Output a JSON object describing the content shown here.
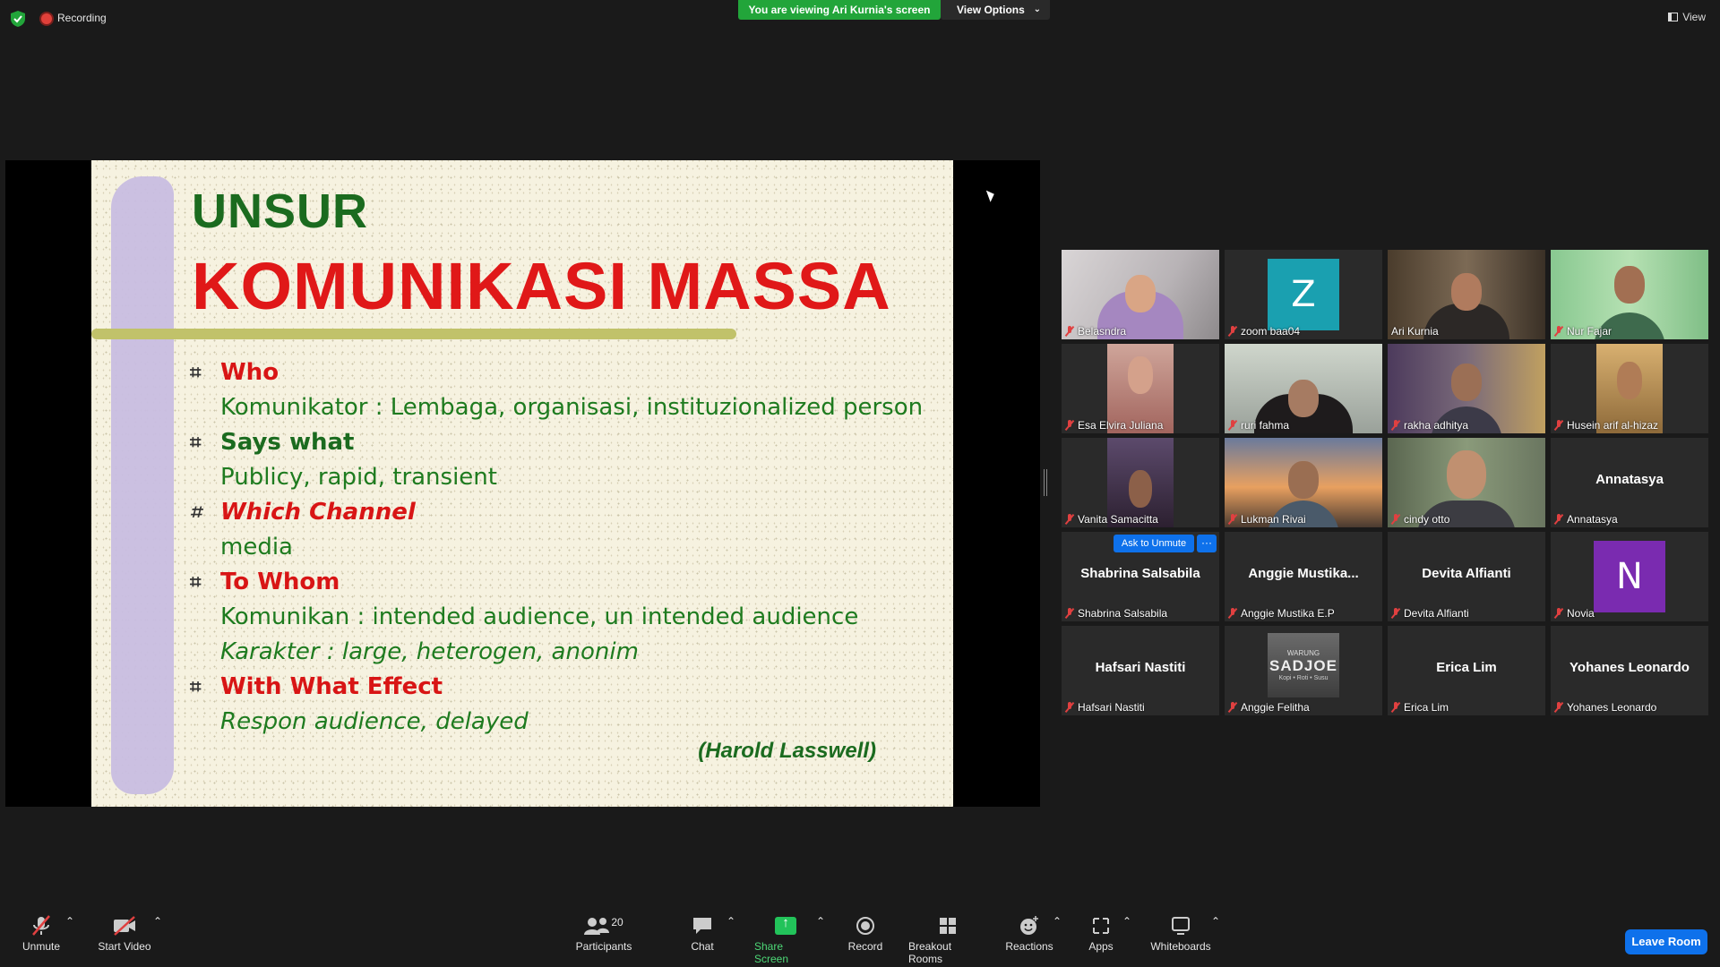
{
  "topbar": {
    "recording_label": "Recording",
    "viewing_banner": "You are viewing Ari Kurnia's screen",
    "view_options_label": "View Options",
    "view_label": "View"
  },
  "slide": {
    "title_line1": "UNSUR",
    "title_line2": "KOMUNIKASI MASSA",
    "lines": [
      "Who",
      "Komunikator : Lembaga, organisasi, instituzionalized person",
      "Says what",
      "Publicy, rapid, transient",
      "Which Channel",
      "media",
      "To Whom",
      "Komunikan : intended audience, un intended audience",
      "Karakter : large, heterogen, anonim",
      "With What Effect",
      "Respon audience, delayed"
    ],
    "attribution": "(Harold Lasswell)"
  },
  "gallery": {
    "ask_to_unmute_label": "Ask to Unmute",
    "more_label": "···",
    "participants": [
      {
        "name": "Belasndra"
      },
      {
        "name": "zoom baa04",
        "avatar_letter": "Z",
        "avatar_color": "#1aa0b0"
      },
      {
        "name": "Ari Kurnia"
      },
      {
        "name": "Nur Fajar"
      },
      {
        "name": "Esa Elvira Juliana"
      },
      {
        "name": "ruri fahma"
      },
      {
        "name": "rakha adhitya"
      },
      {
        "name": "Husein arif al-hizaz"
      },
      {
        "name": "Vanita Samacitta"
      },
      {
        "name": "Lukman Rivai"
      },
      {
        "name": "cindy otto"
      },
      {
        "name": "Annatasya",
        "display_name": "Annatasya"
      },
      {
        "name": "Shabrina Salsabila",
        "display_name": "Shabrina Salsabila"
      },
      {
        "name": "Anggie Mustika E.P",
        "display_name": "Anggie  Mustika..."
      },
      {
        "name": "Devita Alfianti",
        "display_name": "Devita Alfianti"
      },
      {
        "name": "Novia",
        "avatar_letter": "N",
        "avatar_color": "#7a2bb0"
      },
      {
        "name": "Hafsari Nastiti",
        "display_name": "Hafsari Nastiti"
      },
      {
        "name": "Anggie Felitha",
        "logo_line1": "WARUNG",
        "logo_line2": "SADJOE",
        "logo_line3": "Kopi • Roti • Susu"
      },
      {
        "name": "Erica Lim",
        "display_name": "Erica Lim"
      },
      {
        "name": "Yohanes Leonardo",
        "display_name": "Yohanes Leonardo"
      }
    ]
  },
  "toolbar": {
    "unmute": "Unmute",
    "start_video": "Start Video",
    "participants_count": "20",
    "participants": "Participants",
    "chat": "Chat",
    "share_screen": "Share Screen",
    "record": "Record",
    "breakout_rooms": "Breakout Rooms",
    "reactions": "Reactions",
    "apps": "Apps",
    "whiteboards": "Whiteboards",
    "leave_room": "Leave Room"
  },
  "colors": {
    "accent_blue": "#0e71eb",
    "share_green": "#22a53a",
    "active_speaker": "#e6e86a",
    "mute_red": "#e04040"
  }
}
